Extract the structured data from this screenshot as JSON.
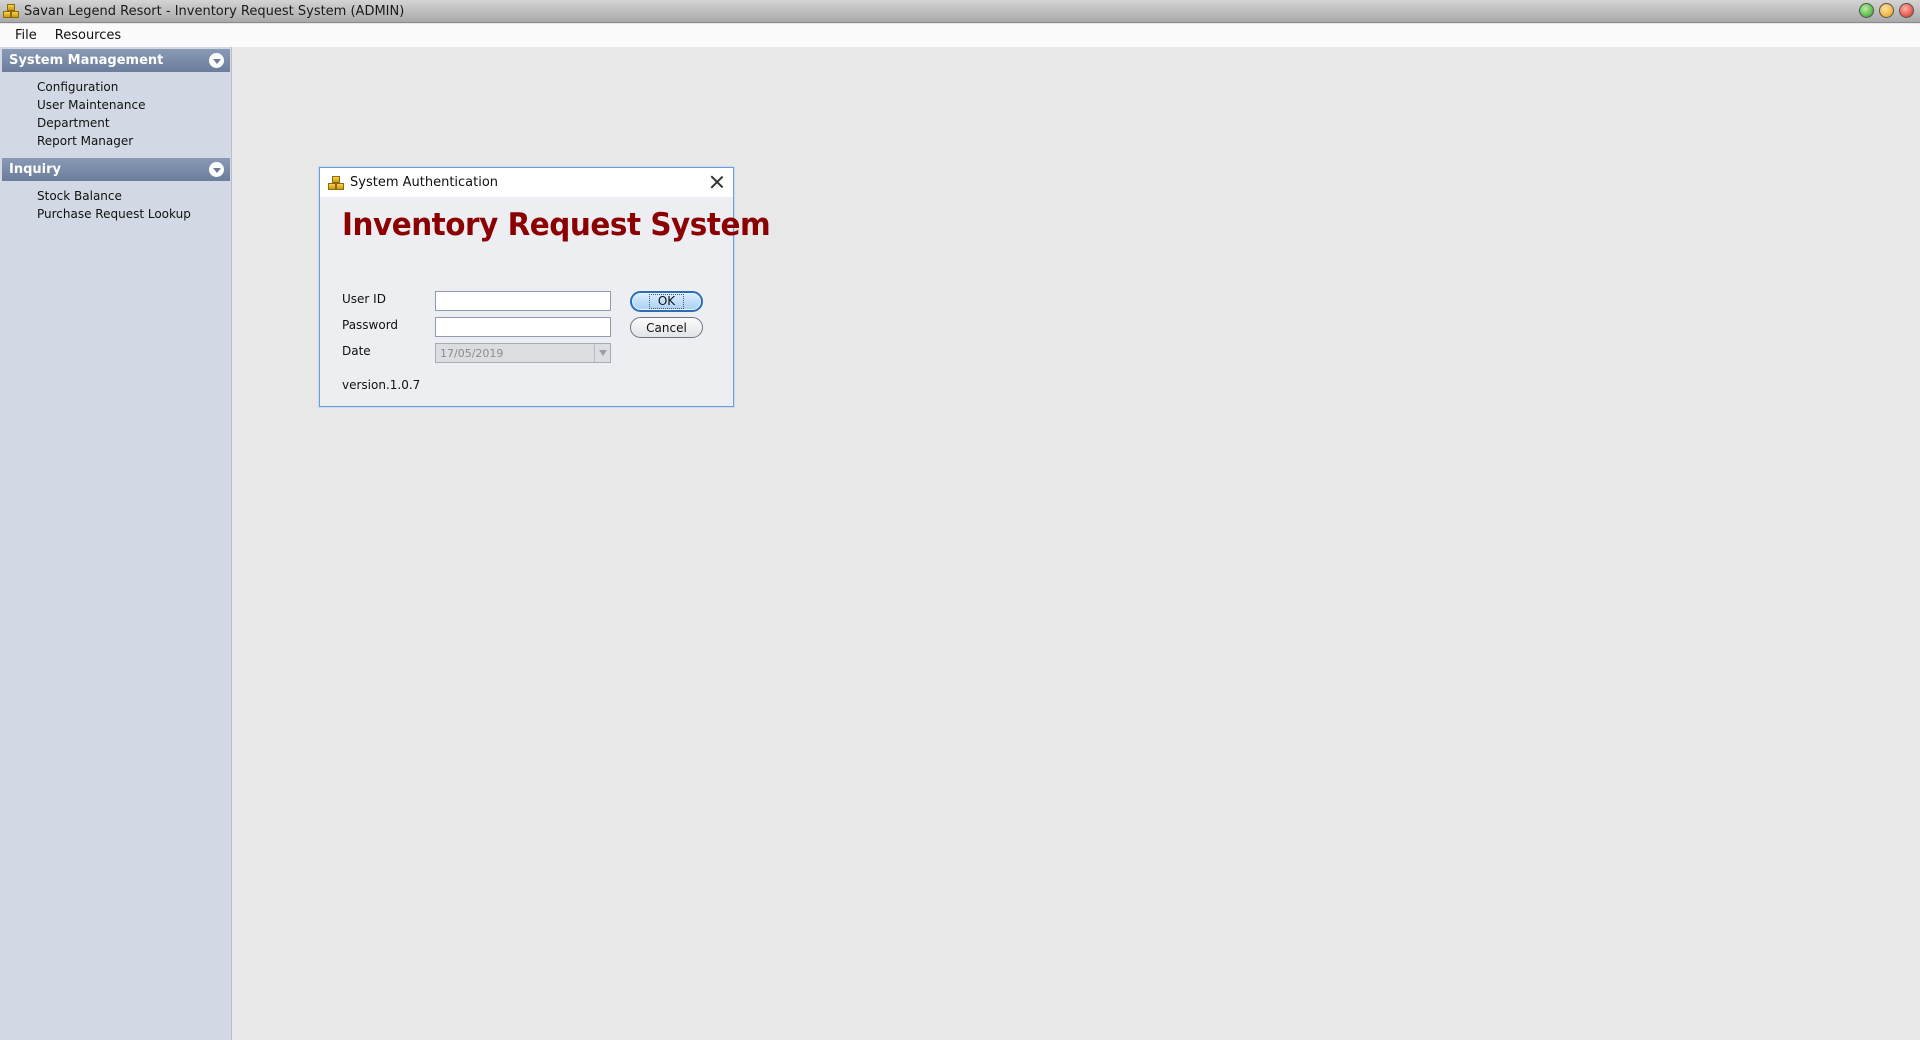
{
  "window": {
    "title": "Savan Legend Resort - Inventory Request System (ADMIN)"
  },
  "menubar": {
    "items": [
      {
        "label": "File"
      },
      {
        "label": "Resources"
      }
    ]
  },
  "sidebar": {
    "groups": [
      {
        "title": "System Management",
        "items": [
          {
            "label": "Configuration"
          },
          {
            "label": "User Maintenance"
          },
          {
            "label": "Department"
          },
          {
            "label": "Report Manager"
          }
        ]
      },
      {
        "title": "Inquiry",
        "items": [
          {
            "label": "Stock Balance"
          },
          {
            "label": "Purchase Request Lookup"
          }
        ]
      }
    ]
  },
  "dialog": {
    "title": "System Authentication",
    "heading": "Inventory Request System",
    "fields": {
      "user_id": {
        "label": "User ID",
        "value": ""
      },
      "password": {
        "label": "Password",
        "value": ""
      },
      "date": {
        "label": "Date",
        "value": "17/05/2019"
      }
    },
    "buttons": {
      "ok": "OK",
      "cancel": "Cancel"
    },
    "version": "version.1.0.7"
  },
  "colors": {
    "heading": "#8b0000",
    "sidebar_bg": "#d3d9e4",
    "group_header": "#7b8caa",
    "desktop_bg": "#e8e8e8",
    "dialog_border": "#6d9ed6"
  }
}
